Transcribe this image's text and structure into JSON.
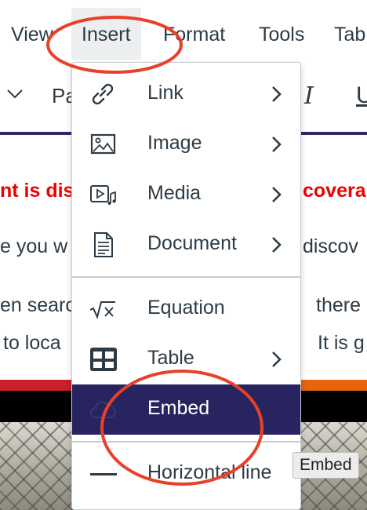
{
  "menubar": {
    "view": "View",
    "insert": "Insert",
    "format": "Format",
    "tools": "Tools",
    "table": "Tab"
  },
  "toolbar": {
    "paragraph_fragment": "Pa",
    "italic": "I",
    "underline": "U"
  },
  "document": {
    "line1_a": "nt is dis",
    "line1_b": "covera",
    "line2_a": "e you w",
    "line2_b": "discov",
    "line3_a": "en searc",
    "line3_b": "there i",
    "line4_a": "to loca",
    "line4_b": "It is g"
  },
  "insert_menu": {
    "items": [
      {
        "label": "Link",
        "icon": "link-icon",
        "submenu": true
      },
      {
        "label": "Image",
        "icon": "image-icon",
        "submenu": true
      },
      {
        "label": "Media",
        "icon": "media-icon",
        "submenu": true
      },
      {
        "label": "Document",
        "icon": "document-icon",
        "submenu": true
      },
      {
        "label": "Equation",
        "icon": "equation-icon",
        "submenu": false
      },
      {
        "label": "Table",
        "icon": "table-icon",
        "submenu": true
      },
      {
        "label": "Embed",
        "icon": "embed-cloud-icon",
        "submenu": false,
        "highlighted": true
      },
      {
        "label": "Horizontal line",
        "icon": "horizontal-line-icon",
        "submenu": false
      }
    ]
  },
  "tooltip": "Embed",
  "colors": {
    "highlight": "#27245f",
    "annotation": "#e8402a",
    "heading_red": "#ee0000",
    "brand_bar_red": "#c9202a",
    "brand_bar_orange": "#e8650d"
  }
}
